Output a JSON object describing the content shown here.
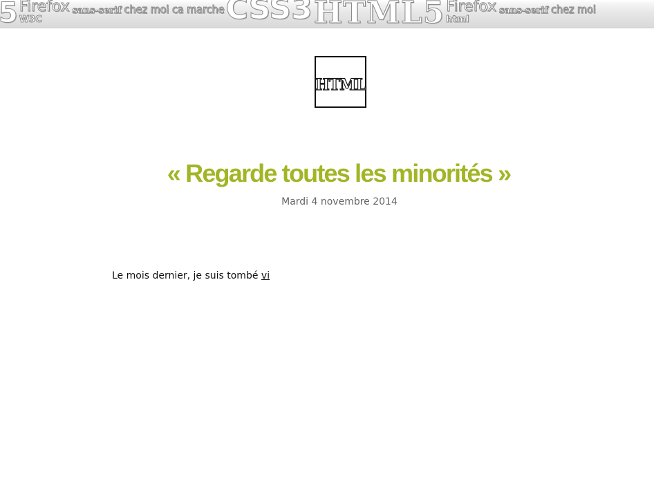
{
  "banner": {
    "words": [
      "5",
      "Firefox",
      "sans-serif",
      "chez moi ca marche",
      "CSS3",
      "HTML5",
      "Firefox",
      "sans-serif",
      "chez moi"
    ],
    "sub": [
      "W3C",
      "html"
    ]
  },
  "logo": {
    "text": "HTML"
  },
  "post": {
    "title": "« Regarde toutes les minorités »",
    "date": "Mardi 4 novembre 2014",
    "body_text": "Le mois dernier, je suis tombé ",
    "body_link": "vi"
  },
  "colors": {
    "title": "#a2b526",
    "date": "#666666",
    "body": "#111111"
  }
}
